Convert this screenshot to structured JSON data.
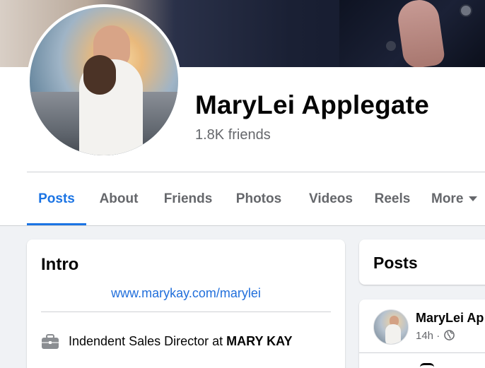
{
  "profile": {
    "name": "MaryLei Applegate",
    "friends": "1.8K friends"
  },
  "tabs": [
    {
      "label": "Posts",
      "active": true
    },
    {
      "label": "About",
      "active": false
    },
    {
      "label": "Friends",
      "active": false
    },
    {
      "label": "Photos",
      "active": false
    },
    {
      "label": "Videos",
      "active": false
    },
    {
      "label": "Reels",
      "active": false
    },
    {
      "label": "More",
      "active": false
    }
  ],
  "intro": {
    "title": "Intro",
    "website": "www.marykay.com/marylei",
    "work_prefix": "Indendent Sales Director at ",
    "work_company": "MARY KAY",
    "work_icon": "briefcase-icon"
  },
  "posts_section": {
    "title": "Posts"
  },
  "post": {
    "author": "MaryLei Ap",
    "time": "14h ·",
    "privacy_icon": "globe-icon"
  },
  "colors": {
    "accent": "#1b74e4",
    "link": "#216fdb",
    "secondary_text": "#65676b",
    "page_bg": "#f0f2f5"
  }
}
